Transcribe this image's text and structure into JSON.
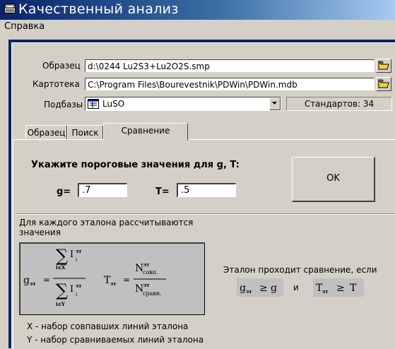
{
  "window": {
    "title": "Качественный анализ"
  },
  "menu": {
    "items": [
      "Справка"
    ]
  },
  "fields": {
    "sample": {
      "label": "Образец",
      "value": "d:\\0244 Lu2S3+Lu2O2S.smp"
    },
    "catalog": {
      "label": "Картотека",
      "value": "C:\\Program Files\\Bourevestnik\\PDWin\\PDWin.mdb"
    },
    "subbase": {
      "label": "Подбазы",
      "value": "LuSO"
    },
    "standards": "Стандартов: 34"
  },
  "tabs": [
    {
      "label": "Образец",
      "active": false
    },
    {
      "label": "Поиск",
      "active": false
    },
    {
      "label": "Сравнение",
      "active": true
    }
  ],
  "comparison": {
    "prompt": "Укажите пороговые значения для g, T:",
    "g_label": "g=",
    "g_value": ".7",
    "t_label": "T=",
    "t_value": ".5",
    "ok_label": "OK",
    "description": "Для каждого эталона рассчитываются значения",
    "pass_text": "Эталон проходит сравнение, если",
    "and_text": "и",
    "legend_x": "X - набор совпавших линий эталона",
    "legend_y": "Y - набор сравниваемых линий эталона"
  },
  "formula": {
    "sum_sub_x": "i∈X",
    "sum_sub_y": "i∈Y",
    "I": "I",
    "i_sub": "i",
    "sup": "эт",
    "g": "g",
    "T": "T",
    "N": "N",
    "n_coinc": "совп.",
    "n_comp": "сравн.",
    "ge": "≥"
  },
  "colors": {
    "titlebar_start": "#0a246a",
    "titlebar_end": "#a6caf0",
    "face": "#d4d0c8",
    "formula_bg": "#c0c0c0",
    "folder": "#f4d03f"
  },
  "icons": [
    "window-app-icon",
    "folder-open-icon",
    "database-icon",
    "chevron-down-icon"
  ]
}
